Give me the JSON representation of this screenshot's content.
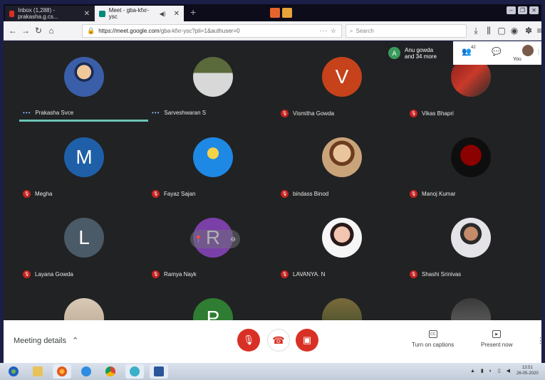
{
  "browser": {
    "tabs": [
      {
        "label": "Inbox (1,288) - prakasha.g.cs...",
        "favicon_color": "#d93025",
        "active": false
      },
      {
        "label": "Meet - gba-kfxr-ysc",
        "favicon_color": "#00897b",
        "active": true
      }
    ],
    "url": "https://meet.google.com/gba-kfxr-ysc?pli=1&authuser=0",
    "url_host": "https://meet.google.com",
    "url_path": "/gba-kfxr-ysc?pli=1&authuser=0",
    "search_placeholder": "Search"
  },
  "meet": {
    "activity": {
      "avatar_letter": "A",
      "text_line1": "Anu gowda",
      "text_line2": "and 34 more"
    },
    "people_count": "42",
    "you_label": "You",
    "participants": [
      {
        "name": "Prakasha Svce",
        "avatar": "ph1",
        "letter": "",
        "status": "speaking"
      },
      {
        "name": "Sarveshwaran S",
        "avatar": "ph2",
        "letter": "",
        "status": "speaking"
      },
      {
        "name": "Vismitha Gowda",
        "avatar": "letter",
        "letter": "V",
        "color": "#c5421b",
        "status": "muted"
      },
      {
        "name": "Vikas Bhapri",
        "avatar": "ph3",
        "letter": "",
        "status": "muted"
      },
      {
        "name": "Megha",
        "avatar": "letter",
        "letter": "M",
        "color": "#1e5fa8",
        "status": "muted"
      },
      {
        "name": "Fayaz Sajan",
        "avatar": "ph4",
        "letter": "",
        "status": "muted"
      },
      {
        "name": "bindass Binod",
        "avatar": "ph5",
        "letter": "",
        "status": "muted"
      },
      {
        "name": "Manoj Kumar",
        "avatar": "ph6",
        "letter": "",
        "status": "muted"
      },
      {
        "name": "Layana Gowda",
        "avatar": "letter",
        "letter": "L",
        "color": "#4a5a66",
        "status": "muted"
      },
      {
        "name": "Ramya Nayk",
        "avatar": "letter",
        "letter": "R",
        "color": "#7b3fa8",
        "status": "muted"
      },
      {
        "name": "LAVANYA. N",
        "avatar": "ph7",
        "letter": "",
        "status": "muted"
      },
      {
        "name": "Shashi Srinivas",
        "avatar": "ph8",
        "letter": "",
        "status": "muted"
      },
      {
        "name": "",
        "avatar": "ph9",
        "letter": "",
        "status": "partial"
      },
      {
        "name": "",
        "avatar": "letter",
        "letter": "P",
        "color": "#2e7d32",
        "status": "partial"
      },
      {
        "name": "",
        "avatar": "ph10",
        "letter": "",
        "status": "partial"
      },
      {
        "name": "",
        "avatar": "ph11",
        "letter": "",
        "status": "partial"
      }
    ]
  },
  "bottom": {
    "meeting_details": "Meeting details",
    "captions_label": "Turn on captions",
    "captions_icon": "CC",
    "present_label": "Present now"
  },
  "taskbar": {
    "time": "13:51",
    "date": "26-05-2020"
  },
  "colors": {
    "mute_red": "#d93025",
    "speaking_bar": "#69c6b8",
    "meet_bg": "#212223"
  }
}
